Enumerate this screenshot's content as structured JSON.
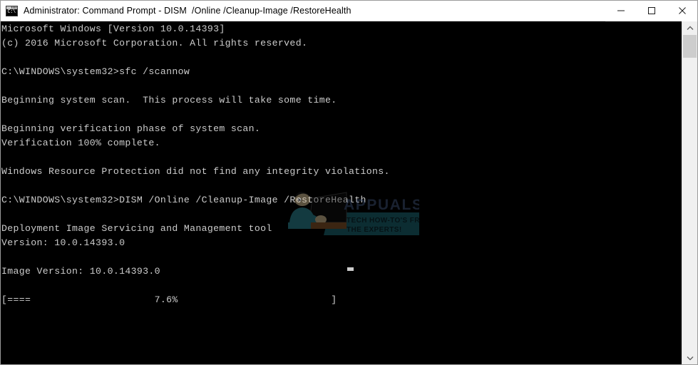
{
  "window": {
    "title": "Administrator: Command Prompt - DISM  /Online /Cleanup-Image /RestoreHealth",
    "icon": "command-prompt-icon",
    "background_color": "#000000",
    "titlebar_color": "#ffffff",
    "text_color": "#cccccc"
  },
  "titlebar_buttons": {
    "minimize_label": "—",
    "maximize_label": "□",
    "close_label": "✕"
  },
  "console": {
    "lines": [
      "Microsoft Windows [Version 10.0.14393]",
      "(c) 2016 Microsoft Corporation. All rights reserved.",
      "",
      "C:\\WINDOWS\\system32>sfc /scannow",
      "",
      "Beginning system scan.  This process will take some time.",
      "",
      "Beginning verification phase of system scan.",
      "Verification 100% complete.",
      "",
      "Windows Resource Protection did not find any integrity violations.",
      "",
      "C:\\WINDOWS\\system32>DISM /Online /Cleanup-Image /RestoreHealth",
      "",
      "Deployment Image Servicing and Management tool",
      "Version: 10.0.14393.0",
      "",
      "Image Version: 10.0.14393.0",
      "",
      "[====                     7.6%                          ]"
    ],
    "full_text": "Microsoft Windows [Version 10.0.14393]\n(c) 2016 Microsoft Corporation. All rights reserved.\n\nC:\\WINDOWS\\system32>sfc /scannow\n\nBeginning system scan.  This process will take some time.\n\nBeginning verification phase of system scan.\nVerification 100% complete.\n\nWindows Resource Protection did not find any integrity violations.\n\nC:\\WINDOWS\\system32>DISM /Online /Cleanup-Image /RestoreHealth\n\nDeployment Image Servicing and Management tool\nVersion: 10.0.14393.0\n\nImage Version: 10.0.14393.0\n\n[====                     7.6%                          ]",
    "commands": [
      "sfc /scannow",
      "DISM /Online /Cleanup-Image /RestoreHealth"
    ],
    "prompt": "C:\\WINDOWS\\system32>",
    "windows_version": "10.0.14393",
    "dism_version": "10.0.14393.0",
    "image_version": "10.0.14393.0",
    "progress_percent": "7.6%",
    "progress_bar_filled": "====",
    "progress_bar_open": "[",
    "progress_bar_close": "]",
    "verification_percent": "100%"
  },
  "watermark": {
    "brand": "APPUALS",
    "tagline_line1": "TECH HOW-TO'S FROM",
    "tagline_line2": "THE EXPERTS!",
    "accent_color": "#2f8a99",
    "brand_color": "#2b3a5c"
  },
  "scrollbar": {
    "up_arrow": "⌃",
    "down_arrow": "⌄",
    "thumb_position": "near-top"
  }
}
